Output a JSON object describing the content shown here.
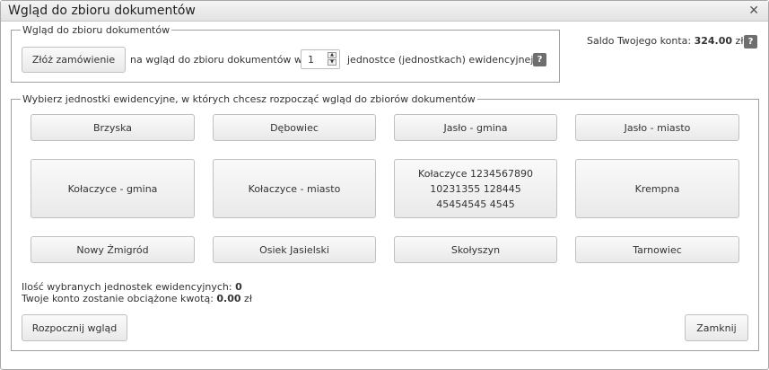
{
  "window": {
    "title": "Wgląd do zbioru dokumentów"
  },
  "order": {
    "legend": "Wgląd do zbioru dokumentów",
    "order_button": "Złóż zamówienie",
    "text_before": "na wgląd do zbioru dokumentów w",
    "quantity": "1",
    "text_after": "jednostce (jednostkach) ewidencyjnej",
    "help": "?"
  },
  "account": {
    "balance_label": "Saldo Twojego konta:",
    "balance_value": "324.00",
    "currency": "zł",
    "help": "?"
  },
  "units": {
    "legend": "Wybierz jednostki ewidencyjne, w których chcesz rozpocząć wgląd do zbiorów dokumentów",
    "items": [
      "Brzyska",
      "Dębowiec",
      "Jasło - gmina",
      "Jasło - miasto",
      "Kołaczyce - gmina",
      "Kołaczyce - miasto",
      "Kołaczyce 1234567890 10231355 128445 45454545 4545",
      "Krempna",
      "Nowy Żmigród",
      "Osiek Jasielski",
      "Skołyszyn",
      "Tarnowiec"
    ]
  },
  "summary": {
    "count_label": "Ilość wybranych jednostek ewidencyjnych:",
    "count_value": "0",
    "charge_label": "Twoje konto zostanie obciążone kwotą:",
    "charge_value": "0.00",
    "charge_currency": "zł"
  },
  "actions": {
    "start": "Rozpocznij wgląd",
    "close": "Zamknij"
  }
}
